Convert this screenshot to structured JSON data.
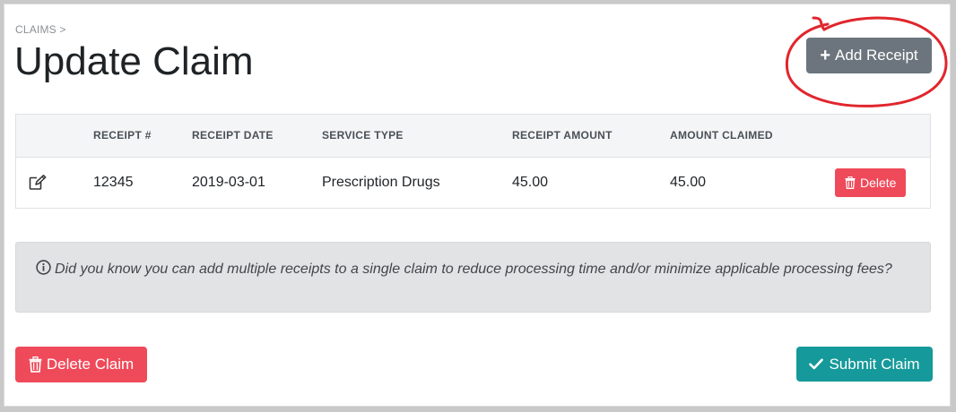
{
  "breadcrumb": "CLAIMS >",
  "page_title": "Update Claim",
  "add_receipt_label": "Add Receipt",
  "table": {
    "headers": [
      "",
      "RECEIPT #",
      "RECEIPT DATE",
      "SERVICE TYPE",
      "RECEIPT AMOUNT",
      "AMOUNT CLAIMED",
      ""
    ],
    "rows": [
      {
        "receipt_number": "12345",
        "receipt_date": "2019-03-01",
        "service_type": "Prescription Drugs",
        "receipt_amount": "45.00",
        "amount_claimed": "45.00",
        "delete_label": "Delete"
      }
    ]
  },
  "info_text": "Did you know you can add multiple receipts to a single claim to reduce processing time and/or minimize applicable processing fees?",
  "delete_claim_label": "Delete Claim",
  "submit_claim_label": "Submit Claim",
  "icons": {
    "add": "plus-icon",
    "edit": "edit-icon",
    "delete": "trash-icon",
    "info": "info-circle-icon",
    "submit": "check-icon"
  },
  "colors": {
    "secondary_button": "#6c757d",
    "danger_button": "#ef4a5a",
    "submit_button": "#16999a",
    "info_background": "#e2e3e5",
    "annotation_circle": "#e0262d"
  }
}
